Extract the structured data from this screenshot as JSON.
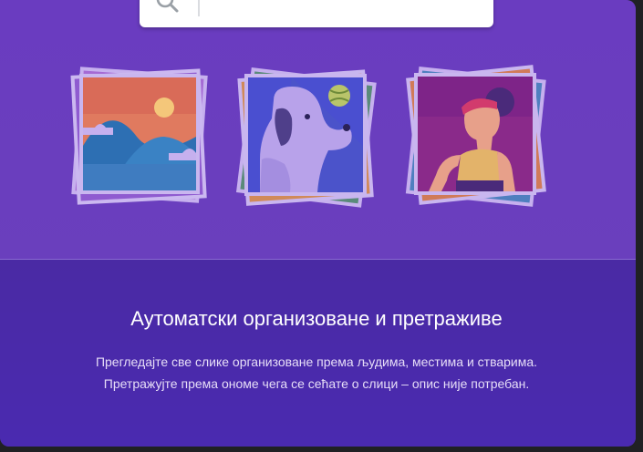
{
  "search": {
    "value": "",
    "placeholder": ""
  },
  "icons": {
    "search": "search-icon",
    "landscape_photo": "landscape-photo-icon",
    "dog_photo": "dog-photo-icon",
    "person_photo": "person-photo-icon"
  },
  "colors": {
    "hero_background": "#6a3cc0",
    "lower_background": "#4a2aa4",
    "title_text": "#ffffff",
    "description_text": "#e6ddf7"
  },
  "content": {
    "title": "Аутоматски организоване и претраживе",
    "description_line1": "Прегледајте све слике организоване према људима, местима и стварима.",
    "description_line2": "Претражујте према ономе чега се сећате о слици – опис није потребан."
  }
}
